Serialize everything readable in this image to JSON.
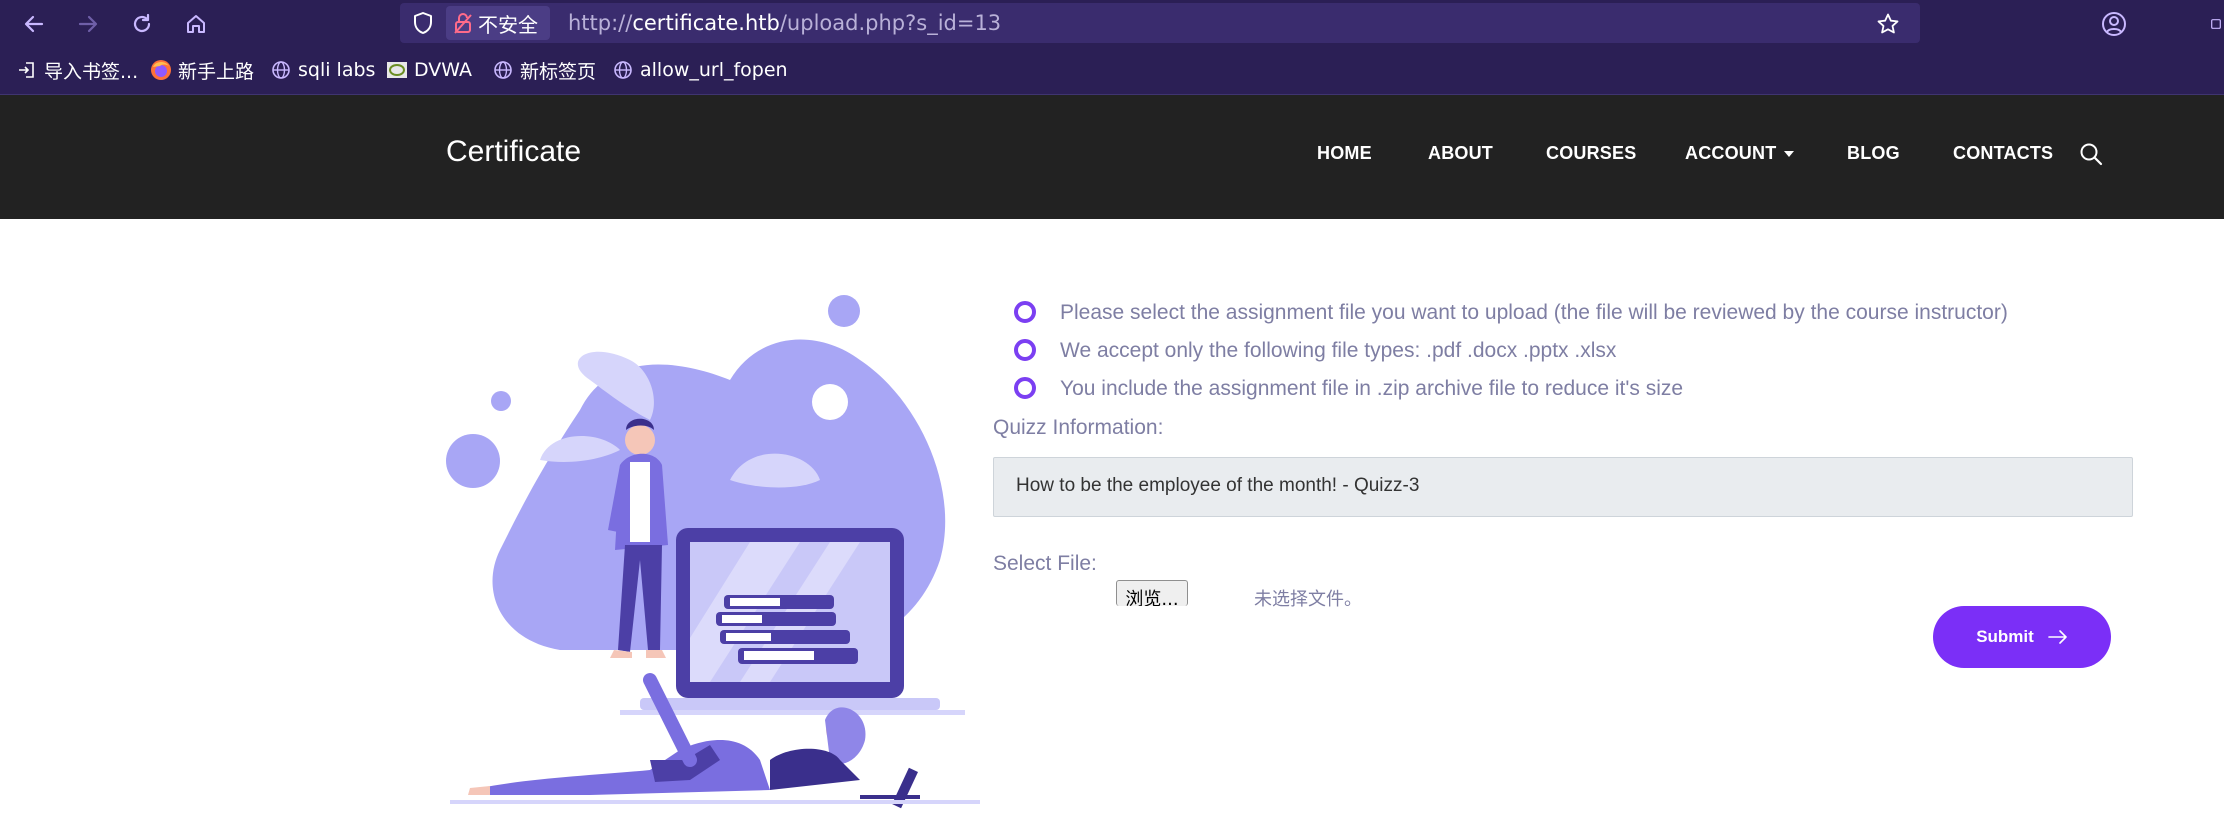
{
  "browser": {
    "insecure_label": "不安全",
    "url_scheme": "http://",
    "url_host": "certificate.htb",
    "url_path": "/upload.php?s_id=13",
    "bookmarks": [
      {
        "label": "导入书签...",
        "icon": "import-icon"
      },
      {
        "label": "新手上路",
        "icon": "firefox-icon"
      },
      {
        "label": "sqli labs",
        "icon": "globe-icon"
      },
      {
        "label": "DVWA",
        "icon": "dvwa-icon"
      },
      {
        "label": "新标签页",
        "icon": "globe-icon"
      },
      {
        "label": "allow_url_fopen",
        "icon": "globe-icon"
      }
    ]
  },
  "site": {
    "brand": "Certificate",
    "menu": [
      {
        "label": "HOME"
      },
      {
        "label": "ABOUT"
      },
      {
        "label": "COURSES"
      },
      {
        "label": "ACCOUNT",
        "dropdown": true
      },
      {
        "label": "BLOG"
      },
      {
        "label": "CONTACTS"
      }
    ]
  },
  "upload": {
    "bullets": [
      "Please select the assignment file you want to upload (the file will be reviewed by the course instructor)",
      "We accept only the following file types: .pdf .docx .pptx .xlsx",
      "You include the assignment file in .zip archive file to reduce it's size"
    ],
    "quiz_label": "Quizz Information:",
    "quiz_value": "How to be the employee of the month! - Quizz-3",
    "file_label": "Select File:",
    "browse_label": "浏览...",
    "no_file_text": "未选择文件。",
    "submit_label": "Submit"
  },
  "colors": {
    "accent": "#7b2ff7",
    "header_bg": "#222222",
    "browser_bg": "#2b1f55",
    "text_muted": "#7e7ea3"
  }
}
